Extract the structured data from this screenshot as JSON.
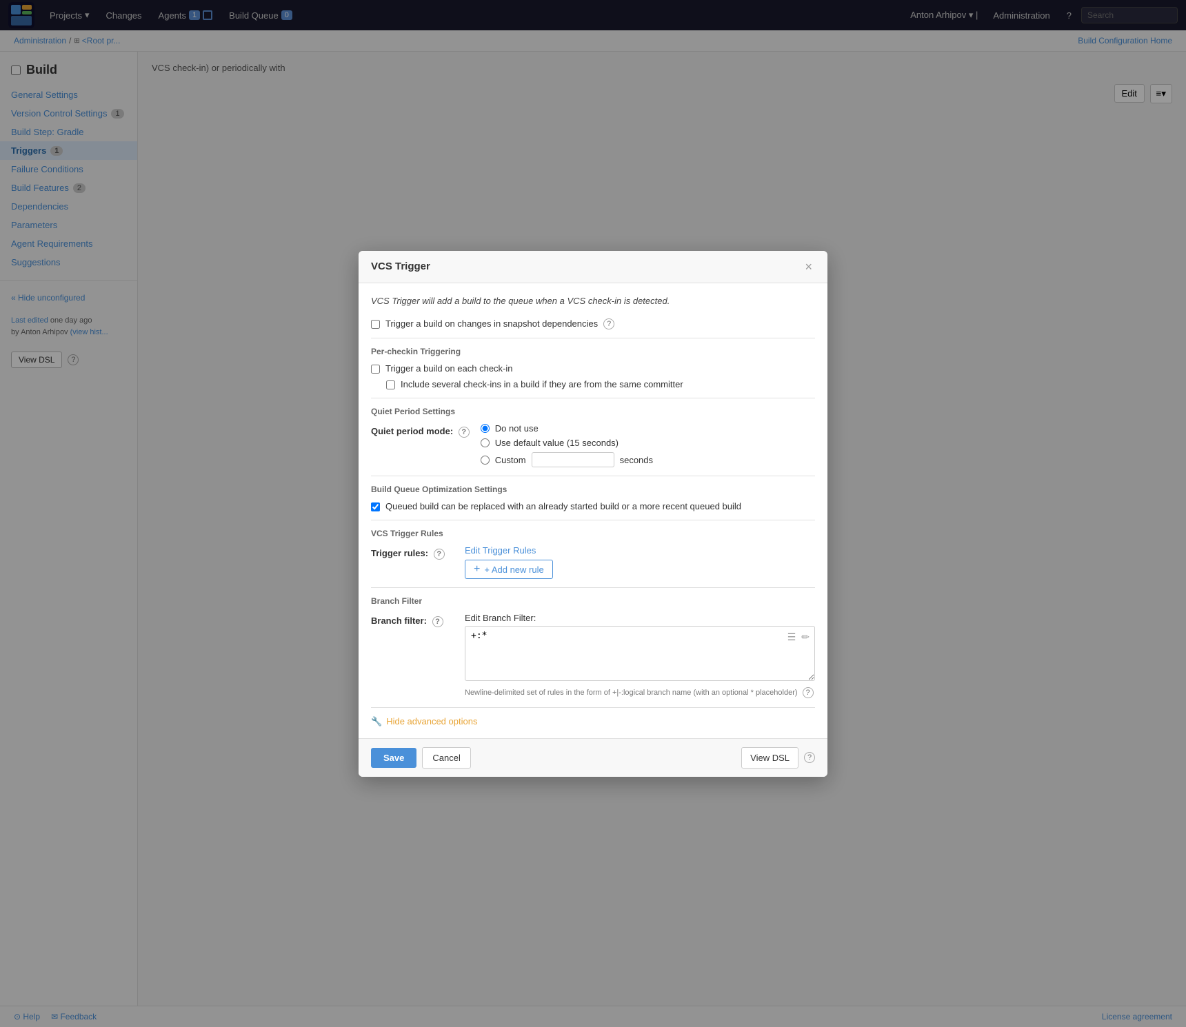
{
  "topnav": {
    "logo_alt": "TeamCity",
    "items": [
      {
        "label": "Projects",
        "has_dropdown": true
      },
      {
        "label": "Changes",
        "has_dropdown": false
      },
      {
        "label": "Agents",
        "badge": "1",
        "has_notif": true
      },
      {
        "label": "Build Queue",
        "badge": "0"
      }
    ],
    "user": "Anton Arhipov",
    "admin_label": "Administration",
    "help_title": "Help",
    "search_placeholder": "Search"
  },
  "breadcrumb": {
    "parts": [
      "Administration",
      "/",
      "<Root pr..."
    ]
  },
  "page_title": "Build",
  "sidebar": {
    "title": "Build",
    "items": [
      {
        "label": "General Settings",
        "active": false,
        "badge": null
      },
      {
        "label": "Version Control Settings",
        "active": false,
        "badge": "1"
      },
      {
        "label": "Build Step: Gradle",
        "active": false,
        "badge": null
      },
      {
        "label": "Triggers",
        "active": true,
        "badge": "1"
      },
      {
        "label": "Failure Conditions",
        "active": false,
        "badge": null
      },
      {
        "label": "Build Features",
        "active": false,
        "badge": "2"
      },
      {
        "label": "Dependencies",
        "active": false,
        "badge": null
      },
      {
        "label": "Parameters",
        "active": false,
        "badge": null
      },
      {
        "label": "Agent Requirements",
        "active": false,
        "badge": null
      },
      {
        "label": "Suggestions",
        "active": false,
        "badge": null
      }
    ],
    "hide_unconfigured_label": "« Hide unconfigured",
    "last_edited_label": "Last edited",
    "last_edited_time": "one day ago",
    "last_edited_by": "by Anton Arhipov",
    "view_history_label": "(view hist...",
    "view_dsl_label": "View DSL"
  },
  "main": {
    "config_home_label": "Build Configuration Home",
    "trigger_desc": "VCS check-in) or periodically with",
    "edit_label": "Edit"
  },
  "modal": {
    "title": "VCS Trigger",
    "close_label": "×",
    "description": "VCS Trigger will add a build to the queue when a VCS check-in is detected.",
    "snapshot_deps_label": "Trigger a build on changes in snapshot dependencies",
    "snapshot_deps_checked": false,
    "per_checkin_section": "Per-checkin Triggering",
    "trigger_each_checkin_label": "Trigger a build on each check-in",
    "trigger_each_checkin_checked": false,
    "include_several_checkins_label": "Include several check-ins in a build if they are from the same committer",
    "include_several_checkins_checked": false,
    "quiet_period_section": "Quiet Period Settings",
    "quiet_period_label": "Quiet period mode:",
    "quiet_period_options": [
      {
        "label": "Do not use",
        "selected": true
      },
      {
        "label": "Use default value (15 seconds)",
        "selected": false
      },
      {
        "label": "Custom",
        "selected": false
      }
    ],
    "seconds_label": "seconds",
    "custom_value": "",
    "queue_optimization_section": "Build Queue Optimization Settings",
    "queue_replace_label": "Queued build can be replaced with an already started build or a more recent queued build",
    "queue_replace_checked": true,
    "trigger_rules_section": "VCS Trigger Rules",
    "trigger_rules_label": "Trigger rules:",
    "edit_trigger_rules_label": "Edit Trigger Rules",
    "add_new_rule_label": "+ Add new rule",
    "branch_filter_section": "Branch Filter",
    "branch_filter_label": "Branch filter:",
    "edit_branch_filter_label": "Edit Branch Filter:",
    "branch_filter_value": "+:*",
    "branch_filter_help": "Newline-delimited set of rules in the form of +|-:logical branch name (with an optional * placeholder)",
    "hide_advanced_label": "Hide advanced options",
    "save_label": "Save",
    "cancel_label": "Cancel",
    "view_dsl_label": "View DSL"
  },
  "footer": {
    "help_label": "Help",
    "feedback_label": "Feedback",
    "license_label": "License agreement"
  }
}
